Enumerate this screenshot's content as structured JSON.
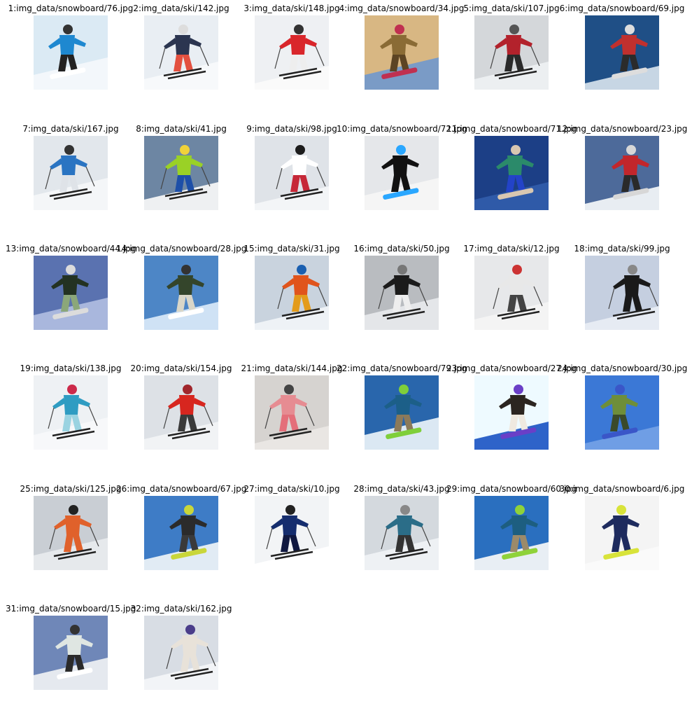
{
  "images": [
    {
      "label": "1:img_data/snowboard/76.jpg",
      "kind": "snowboard",
      "palette": {
        "bg": "#dbeaf4",
        "snow": "#f3f7fb",
        "body": "#1e88d0",
        "pants": "#222222",
        "gear": "#ffffff"
      }
    },
    {
      "label": "2:img_data/ski/142.jpg",
      "kind": "ski",
      "palette": {
        "bg": "#e9eef3",
        "snow": "#f7f9fb",
        "body": "#2b3550",
        "pants": "#e3503f",
        "gear": "#dddddd"
      }
    },
    {
      "label": "3:img_data/ski/148.jpg",
      "kind": "ski",
      "palette": {
        "bg": "#eef0f3",
        "snow": "#fafafa",
        "body": "#d9262b",
        "pants": "#eeeeee",
        "gear": "#333333"
      }
    },
    {
      "label": "4:img_data/snowboard/34.jpg",
      "kind": "snowboard",
      "palette": {
        "bg": "#d8b783",
        "snow": "#7a9bc6",
        "body": "#8a6b35",
        "pants": "#5c4423",
        "gear": "#c03050"
      }
    },
    {
      "label": "5:img_data/ski/107.jpg",
      "kind": "ski",
      "palette": {
        "bg": "#d4d7da",
        "snow": "#eceff1",
        "body": "#b3222c",
        "pants": "#2a2a2a",
        "gear": "#555555"
      }
    },
    {
      "label": "6:img_data/snowboard/69.jpg",
      "kind": "snowboard",
      "palette": {
        "bg": "#1f4f86",
        "snow": "#c7d6e4",
        "body": "#c0302e",
        "pants": "#2b2b2b",
        "gear": "#dddddd"
      }
    },
    {
      "label": "7:img_data/ski/167.jpg",
      "kind": "ski",
      "palette": {
        "bg": "#e2e7ec",
        "snow": "#f4f6f8",
        "body": "#2a74c2",
        "pants": "#dfe3e8",
        "gear": "#333333"
      }
    },
    {
      "label": "8:img_data/ski/41.jpg",
      "kind": "ski",
      "palette": {
        "bg": "#6d86a3",
        "snow": "#eef0f2",
        "body": "#9ad126",
        "pants": "#1d4fa8",
        "gear": "#f0d23a"
      }
    },
    {
      "label": "9:img_data/ski/98.jpg",
      "kind": "ski",
      "palette": {
        "bg": "#dfe3e8",
        "snow": "#f3f5f7",
        "body": "#ffffff",
        "pants": "#c62838",
        "gear": "#1c1c1c"
      }
    },
    {
      "label": "10:img_data/snowboard/72.jpg",
      "kind": "snowboard",
      "palette": {
        "bg": "#e5e7ea",
        "snow": "#f5f5f5",
        "body": "#111111",
        "pants": "#111111",
        "gear": "#2aa7ff"
      }
    },
    {
      "label": "11:img_data/snowboard/71.jpg",
      "kind": "snowboard",
      "palette": {
        "bg": "#1c3f86",
        "snow": "#2f5aa8",
        "body": "#2b8a6a",
        "pants": "#2343c8",
        "gear": "#d8c7b1"
      }
    },
    {
      "label": "12:img_data/snowboard/23.jpg",
      "kind": "snowboard",
      "palette": {
        "bg": "#4d6a9a",
        "snow": "#e8edf2",
        "body": "#c2262b",
        "pants": "#2a2a2a",
        "gear": "#d7d7d7"
      }
    },
    {
      "label": "13:img_data/snowboard/44.jpg",
      "kind": "snowboard",
      "palette": {
        "bg": "#5a72b0",
        "snow": "#a9b7dd",
        "body": "#233222",
        "pants": "#8ba77a",
        "gear": "#dcdcdc"
      }
    },
    {
      "label": "14:img_data/snowboard/28.jpg",
      "kind": "snowboard",
      "palette": {
        "bg": "#4d86c6",
        "snow": "#cfe2f5",
        "body": "#34452b",
        "pants": "#d9d6c8",
        "gear": "#ffffff"
      }
    },
    {
      "label": "15:img_data/ski/31.jpg",
      "kind": "ski",
      "palette": {
        "bg": "#c9d3de",
        "snow": "#eef2f6",
        "body": "#e0541c",
        "pants": "#e39b1b",
        "gear": "#1a5fb0"
      }
    },
    {
      "label": "16:img_data/ski/50.jpg",
      "kind": "ski",
      "palette": {
        "bg": "#b9bcc0",
        "snow": "#e4e6e9",
        "body": "#1b1b1b",
        "pants": "#eeeeee",
        "gear": "#777777"
      }
    },
    {
      "label": "17:img_data/ski/12.jpg",
      "kind": "ski",
      "palette": {
        "bg": "#e7e8ea",
        "snow": "#f4f4f4",
        "body": "#e8e8e8",
        "pants": "#444444",
        "gear": "#cc3333"
      }
    },
    {
      "label": "18:img_data/ski/99.jpg",
      "kind": "ski",
      "palette": {
        "bg": "#c5cfe0",
        "snow": "#e6ebf3",
        "body": "#1a1a1a",
        "pants": "#1a1a1a",
        "gear": "#888888"
      }
    },
    {
      "label": "19:img_data/ski/138.jpg",
      "kind": "ski",
      "palette": {
        "bg": "#eef1f4",
        "snow": "#f7f8fa",
        "body": "#2f9cc2",
        "pants": "#9ad3e1",
        "gear": "#cc2a4a"
      }
    },
    {
      "label": "20:img_data/ski/154.jpg",
      "kind": "ski",
      "palette": {
        "bg": "#dde1e6",
        "snow": "#f1f3f5",
        "body": "#d7261f",
        "pants": "#3a3a3a",
        "gear": "#a0262c"
      }
    },
    {
      "label": "21:img_data/ski/144.jpg",
      "kind": "ski",
      "palette": {
        "bg": "#d6d3d0",
        "snow": "#e9e6e3",
        "body": "#e68c92",
        "pants": "#e46f7a",
        "gear": "#444444"
      }
    },
    {
      "label": "22:img_data/snowboard/79.jpg",
      "kind": "snowboard",
      "palette": {
        "bg": "#2966ac",
        "snow": "#dbe8f3",
        "body": "#1c5f88",
        "pants": "#8b7a5a",
        "gear": "#7fcf3a"
      }
    },
    {
      "label": "23:img_data/snowboard/27.jpg",
      "kind": "snowboard",
      "palette": {
        "bg": "#eefaff",
        "snow": "#2e63c9",
        "body": "#2b2520",
        "pants": "#efe9e0",
        "gear": "#6a3fc7"
      }
    },
    {
      "label": "24:img_data/snowboard/30.jpg",
      "kind": "snowboard",
      "palette": {
        "bg": "#3b78d6",
        "snow": "#6f9ee5",
        "body": "#6e8e3a",
        "pants": "#3a4a2a",
        "gear": "#3a56c8"
      }
    },
    {
      "label": "25:img_data/ski/125.jpg",
      "kind": "ski",
      "palette": {
        "bg": "#c9ced4",
        "snow": "#e6e9ec",
        "body": "#e0612b",
        "pants": "#e0612b",
        "gear": "#222222"
      }
    },
    {
      "label": "26:img_data/snowboard/67.jpg",
      "kind": "snowboard",
      "palette": {
        "bg": "#3e7cc6",
        "snow": "#e1ebf4",
        "body": "#2b2b2b",
        "pants": "#3a3a3a",
        "gear": "#c9d63a"
      }
    },
    {
      "label": "27:img_data/ski/10.jpg",
      "kind": "ski",
      "palette": {
        "bg": "#f2f4f6",
        "snow": "#ffffff",
        "body": "#152d6e",
        "pants": "#101840",
        "gear": "#222222"
      }
    },
    {
      "label": "28:img_data/ski/43.jpg",
      "kind": "ski",
      "palette": {
        "bg": "#d4d9de",
        "snow": "#eef1f4",
        "body": "#2b6d88",
        "pants": "#333333",
        "gear": "#888888"
      }
    },
    {
      "label": "29:img_data/snowboard/60.jpg",
      "kind": "snowboard",
      "palette": {
        "bg": "#2a6fbf",
        "snow": "#e8eef4",
        "body": "#1d5e80",
        "pants": "#9b8a6a",
        "gear": "#8fd23a"
      }
    },
    {
      "label": "30:img_data/snowboard/6.jpg",
      "kind": "snowboard",
      "palette": {
        "bg": "#f4f4f4",
        "snow": "#fafafa",
        "body": "#1e2b5e",
        "pants": "#1e2b5e",
        "gear": "#d8e33a"
      }
    },
    {
      "label": "31:img_data/snowboard/15.jpg",
      "kind": "snowboard",
      "palette": {
        "bg": "#6f87b8",
        "snow": "#e5e9ef",
        "body": "#dfe6e2",
        "pants": "#2a2a2a",
        "gear": "#ffffff"
      }
    },
    {
      "label": "32:img_data/ski/162.jpg",
      "kind": "ski",
      "palette": {
        "bg": "#d8dde4",
        "snow": "#f2f4f7",
        "body": "#e8e2d9",
        "pants": "#e8e2d9",
        "gear": "#4a3d8a"
      }
    }
  ]
}
